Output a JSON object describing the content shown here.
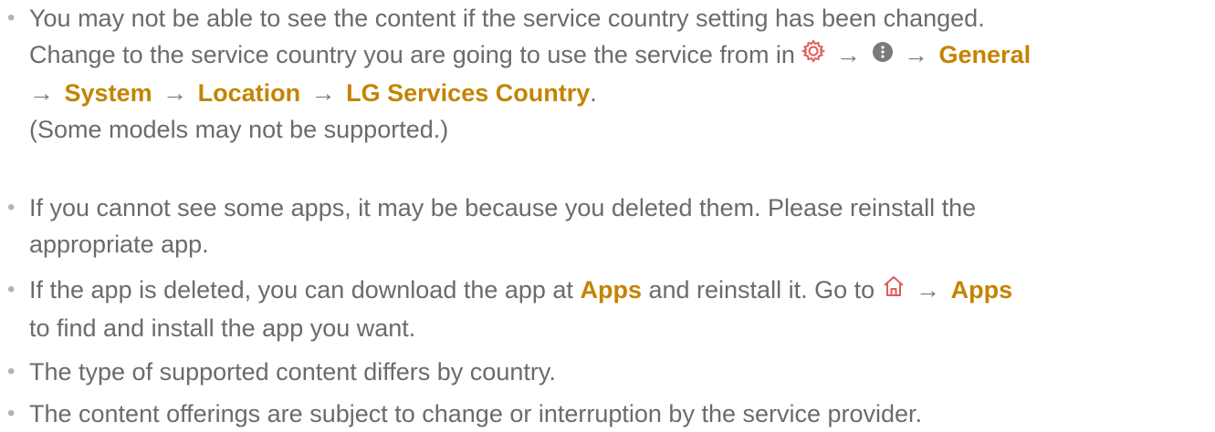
{
  "items": [
    {
      "line1": "You may not be able to see the content if the service country setting has been changed.",
      "line2_prefix": "Change to the service country you are going to use the service from in",
      "path_general": "General",
      "path_system": "System",
      "path_location": "Location",
      "path_country": "LG Services Country",
      "period": ".",
      "note": "(Some models may not be supported.)"
    },
    {
      "line1": "If you cannot see some apps, it may be because you deleted them. Please reinstall the",
      "line2": "appropriate app."
    },
    {
      "line1_prefix": "If the app is deleted, you can download the app at",
      "apps_label": "Apps",
      "line1_mid": "and reinstall it. Go to",
      "apps_label_2": "Apps",
      "line2": "to find and install the app you want."
    },
    {
      "text": "The type of supported content differs by country."
    },
    {
      "text": "The content offerings are subject to change or interruption by the service provider."
    }
  ],
  "icons": {
    "settings": "gear-icon",
    "more": "more-options-icon",
    "home": "home-icon",
    "arrow": "arrow-right-icon"
  },
  "colors": {
    "text": "#6b6b6b",
    "highlight": "#c38400",
    "icon_red": "#e35a5a",
    "bullet": "#b3b3b3"
  },
  "arrow_glyph": "→"
}
